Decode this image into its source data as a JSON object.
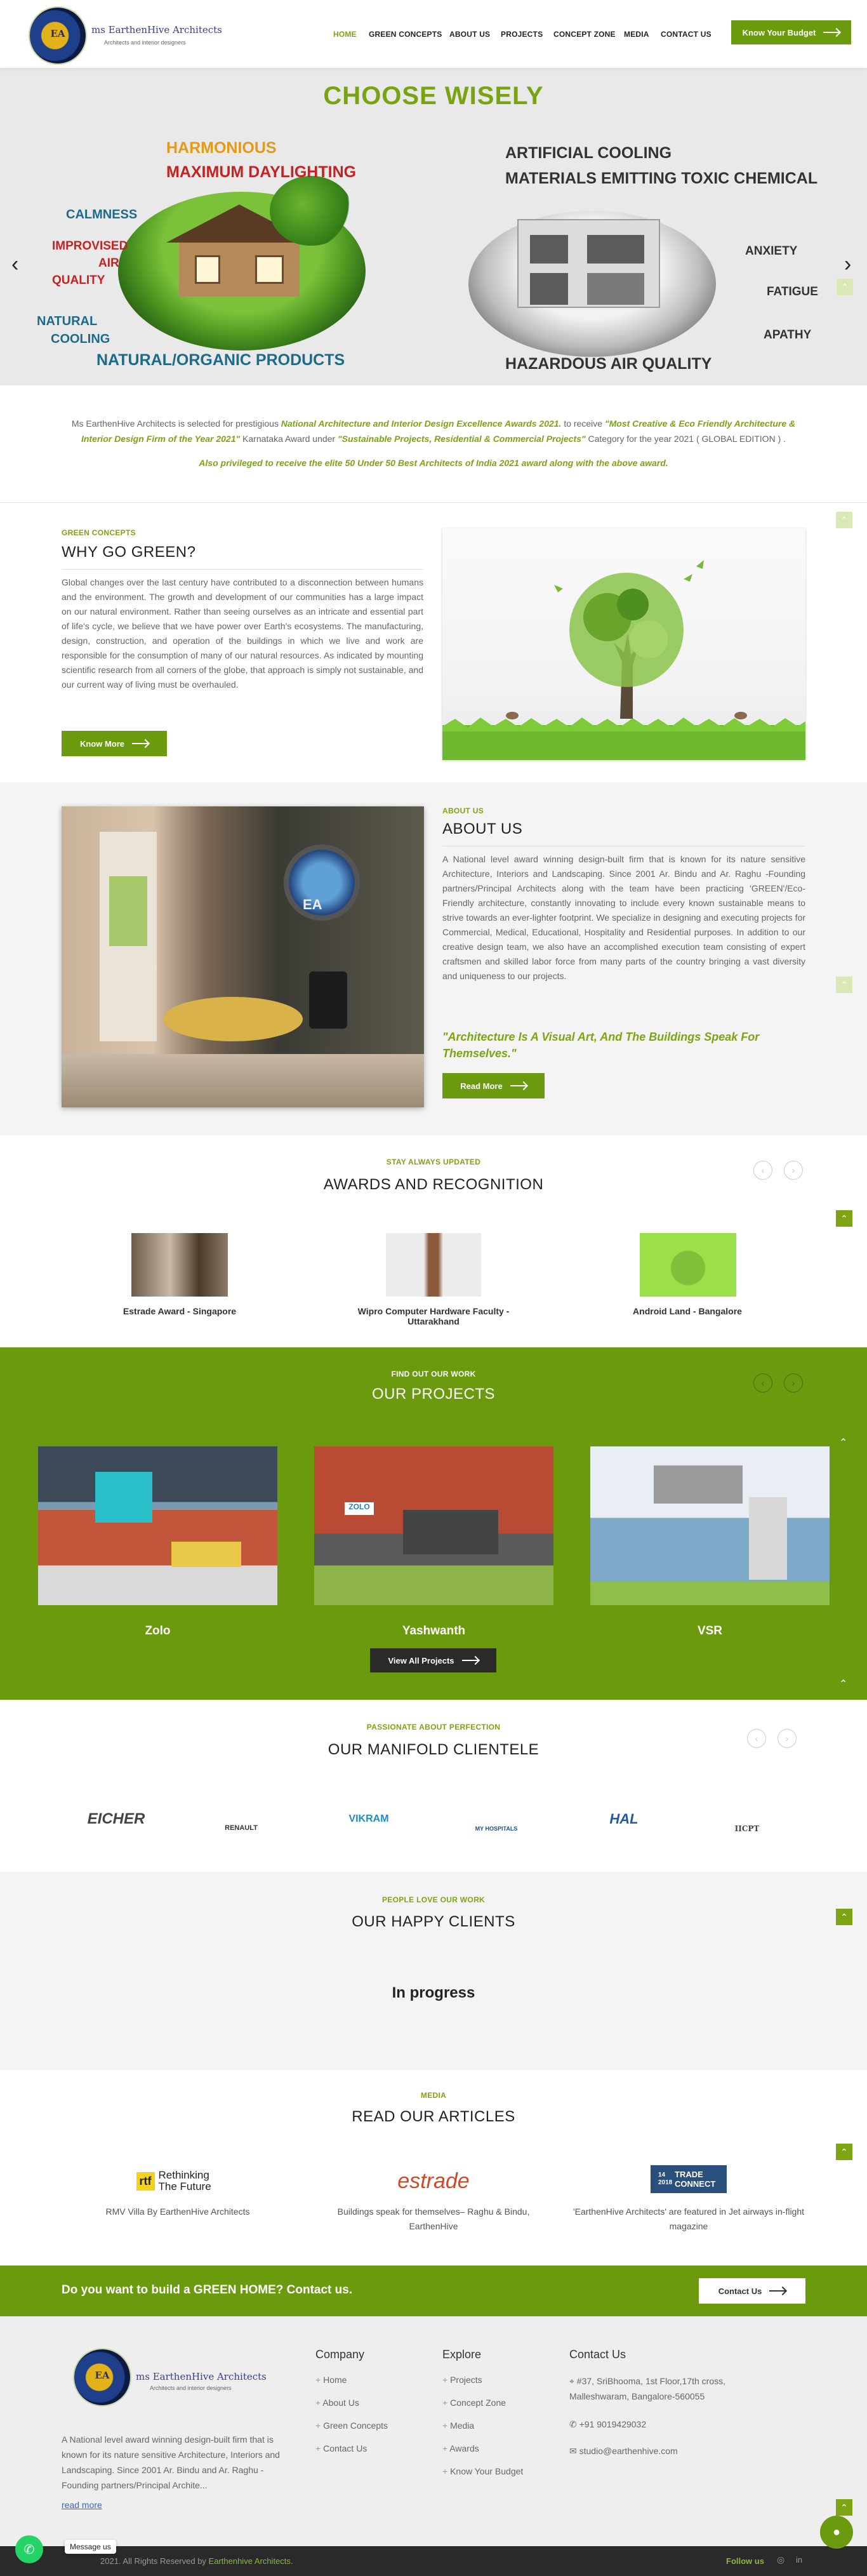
{
  "brand": {
    "logo_letters": "EA",
    "name": "ms EarthenHive Architects",
    "tagline": "Architects and interior designers"
  },
  "nav": {
    "items": [
      "HOME",
      "GREEN CONCEPTS",
      "ABOUT US",
      "PROJECTS",
      "CONCEPT ZONE",
      "MEDIA",
      "CONTACT US"
    ],
    "cta": "Know Your Budget"
  },
  "hero": {
    "title": "CHOOSE WISELY",
    "left_words": [
      "HARMONIOUS",
      "MAXIMUM DAYLIGHTING",
      "CALMNESS",
      "IMPROVISED",
      "AIR",
      "QUALITY",
      "NATURAL",
      "COOLING",
      "NATURAL/ORGANIC PRODUCTS"
    ],
    "right_words": [
      "ARTIFICIAL COOLING",
      "MATERIALS EMITTING TOXIC CHEMICAL",
      "ANXIETY",
      "FATIGUE",
      "APATHY",
      "HAZARDOUS AIR QUALITY"
    ],
    "prev": "‹",
    "next": "›"
  },
  "award_strip": {
    "t1": "Ms EarthenHive Architects is selected for prestigious ",
    "b1": "National Architecture and Interior Design Excellence Awards 2021.",
    "t2": " to receive ",
    "b2": "\"Most Creative & Eco Friendly Architecture & Interior Design Firm of the Year 2021\"",
    "t3": " Karnataka Award under ",
    "b3": "\"Sustainable Projects, Residential & Commercial Projects\"",
    "t4": " Category for the year 2021 ( GLOBAL EDITION ) .",
    "line2": "Also privileged to receive the elite 50 Under 50 Best Architects of India 2021 award along with the above award."
  },
  "green": {
    "eyebrow": "GREEN CONCEPTS",
    "title": "WHY GO GREEN?",
    "body": "Global changes over the last century have contributed to a disconnection between humans and the environment. The growth and development of our communities has a large impact on our natural environment. Rather than seeing ourselves as an intricate and essential part of life's cycle, we believe that we have power over Earth's ecosystems. The manufacturing, design, construction, and operation of the buildings in which we live and work are responsible for the consumption of many of our natural resources. As indicated by mounting scientific research from all corners of the globe, that approach is simply not sustainable, and our current way of living must be overhauled.",
    "button": "Know More"
  },
  "about": {
    "eyebrow": "ABOUT US",
    "title": "ABOUT US",
    "body": "A National level award winning design-built firm that is known for its nature sensitive Architecture, Interiors and Landscaping. Since 2001 Ar. Bindu and Ar. Raghu -Founding partners/Principal Architects along with the team have been practicing 'GREEN'/Eco-Friendly architecture, constantly innovating to include every known sustainable means to strive towards an ever-lighter footprint. We specialize in designing and executing projects for Commercial, Medical, Educational, Hospitality and Residential purposes. In addition to our creative design team, we also have an accomplished execution team consisting of expert craftsmen and skilled labor force from many parts of the country bringing a vast diversity and uniqueness to our projects.",
    "quote": "\"Architecture Is A Visual Art, And The Buildings Speak For Themselves.\"",
    "button": "Read More",
    "img_logo": "EA"
  },
  "awards": {
    "eyebrow": "STAY ALWAYS UPDATED",
    "title": "AWARDS AND RECOGNITION",
    "items": [
      {
        "caption": "Estrade Award - Singapore"
      },
      {
        "caption": "Wipro Computer Hardware Faculty - Uttarakhand"
      },
      {
        "caption": "Android Land - Bangalore"
      }
    ]
  },
  "projects": {
    "eyebrow": "FIND OUT OUR WORK",
    "title": "OUR PROJECTS",
    "items": [
      {
        "name": "Zolo",
        "sign": ""
      },
      {
        "name": "Yashwanth",
        "sign": "ZOLO"
      },
      {
        "name": "VSR",
        "sign": ""
      }
    ],
    "button": "View All Projects"
  },
  "clients": {
    "eyebrow": "PASSIONATE ABOUT PERFECTION",
    "title": "OUR MANIFOLD CLIENTELE",
    "logos": [
      "EICHER",
      "RENAULT",
      "VIKRAM",
      "MY HOSPITALS",
      "HAL",
      "IICPT"
    ]
  },
  "happy": {
    "eyebrow": "PEOPLE LOVE OUR WORK",
    "title": "OUR HAPPY CLIENTS",
    "status": "In progress"
  },
  "media": {
    "eyebrow": "MEDIA",
    "title": "READ OUR ARTICLES",
    "items": [
      {
        "logo": "Rethinking The Future",
        "logo_mark": "rtf",
        "caption": "RMV Villa By EarthenHive Architects"
      },
      {
        "logo": "estrade",
        "caption": "Buildings speak for themselves– Raghu & Bindu, EarthenHive"
      },
      {
        "logo": "TRADE CONNECT",
        "logo_date": "14 2018",
        "caption": "'EarthenHive Architects' are featured in Jet airways in-flight magazine"
      }
    ]
  },
  "cta": {
    "text": "Do you want to build a GREEN HOME? Contact us.",
    "button": "Contact Us"
  },
  "footer": {
    "about": "A National level award winning design-built firm that is known for its nature sensitive Architecture, Interiors and Landscaping. Since 2001 Ar. Bindu and Ar. Raghu -Founding partners/Principal Archite...",
    "read_more": "read more",
    "company_title": "Company",
    "company_links": [
      "Home",
      "About Us",
      "Green Concepts",
      "Contact Us"
    ],
    "explore_title": "Explore",
    "explore_links": [
      "Projects",
      "Concept Zone",
      "Media",
      "Awards",
      "Know Your Budget"
    ],
    "contact_title": "Contact Us",
    "address": "#37, SriBhooma, 1st Floor,17th cross, Malleshwaram, Bangalore-560055",
    "phone": "+91 9019429032",
    "email": "studio@earthenhive.com"
  },
  "copyright": {
    "text": "2021. All Rights Reserved by ",
    "brand": "Earthenhive Architects.",
    "follow": "Follow us"
  },
  "whatsapp": {
    "label": "Message us"
  },
  "colors": {
    "accent": "#7ea313",
    "accent_dark": "#6b9a0f"
  }
}
